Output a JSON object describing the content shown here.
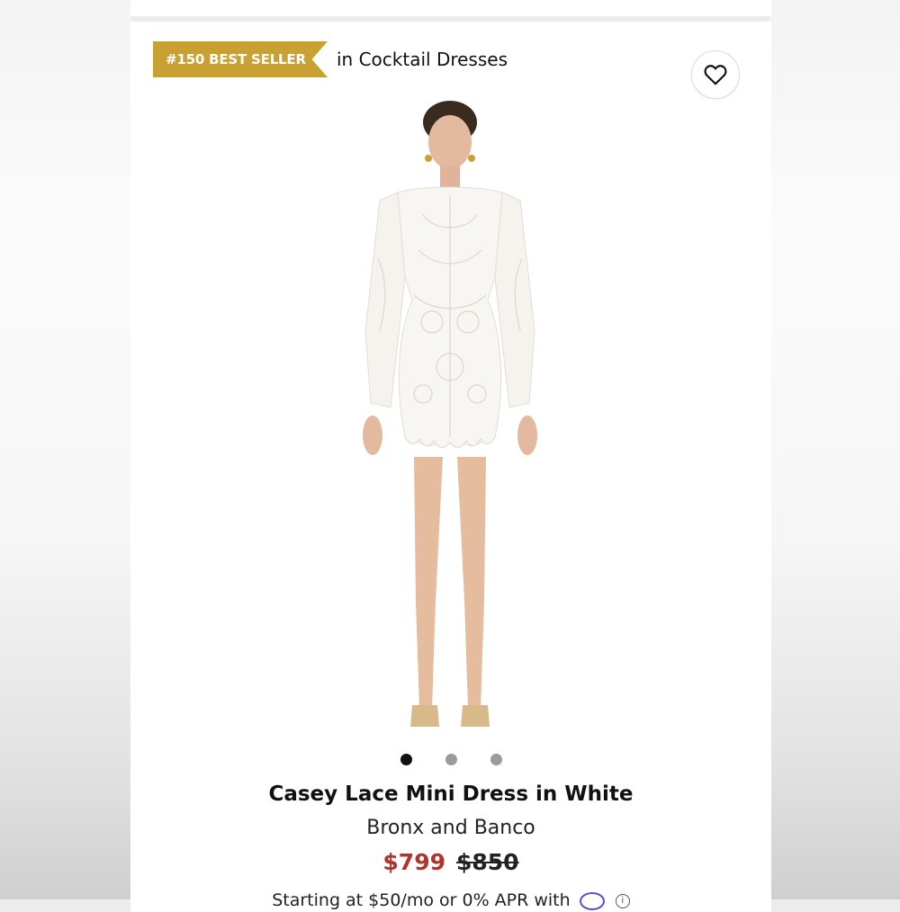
{
  "badge": {
    "rank_label": "#150 BEST SELLER",
    "context": "in Cocktail Dresses",
    "color": "#c9a032"
  },
  "favorite": {
    "icon": "heart-icon"
  },
  "product": {
    "title": "Casey Lace Mini Dress in White",
    "brand": "Bronx and Banco",
    "sale_price": "$799",
    "original_price": "$850",
    "sale_color": "#b0332c",
    "financing_text": "Starting at $50/mo or 0% APR with"
  },
  "gallery": {
    "total_images": 3,
    "active_index": 0
  }
}
